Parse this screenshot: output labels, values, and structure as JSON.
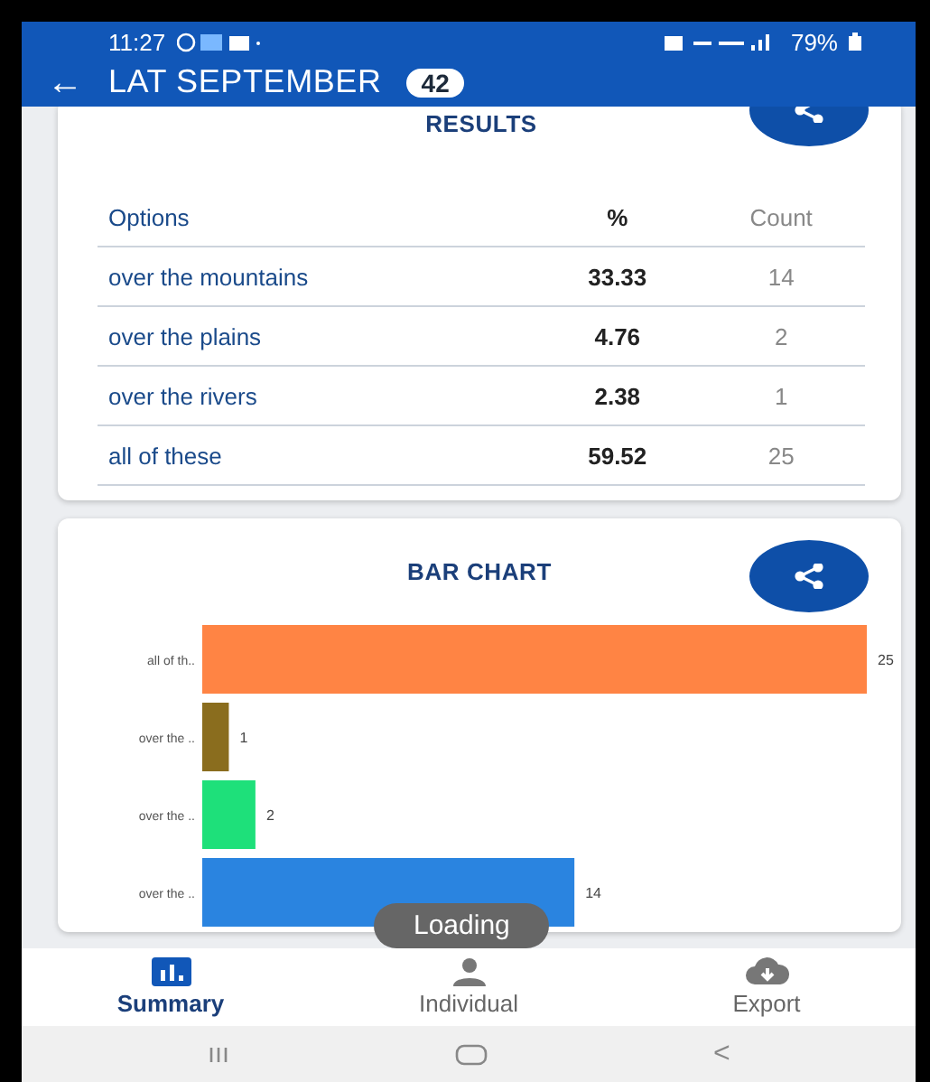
{
  "status_bar": {
    "time": "11:27",
    "battery": "79%"
  },
  "app_bar": {
    "back": "←",
    "title": "LAT SEPTEMBER",
    "badge": "42"
  },
  "results": {
    "title": "RESULTS",
    "columns": [
      "Options",
      "%",
      "Count"
    ],
    "rows": [
      {
        "option": "over the mountains",
        "percent": "33.33",
        "count": "14"
      },
      {
        "option": "over the plains",
        "percent": "4.76",
        "count": "2"
      },
      {
        "option": "over the rivers",
        "percent": "2.38",
        "count": "1"
      },
      {
        "option": "all of these",
        "percent": "59.52",
        "count": "25"
      }
    ]
  },
  "bar_chart": {
    "title": "BAR CHART",
    "chart_data": {
      "type": "bar",
      "orientation": "horizontal",
      "categories": [
        "all of th..",
        "over the ..",
        "over the ..",
        "over the .."
      ],
      "values": [
        25,
        1,
        2,
        14
      ],
      "colors": [
        "#ff8444",
        "#8a6d1e",
        "#1ee07a",
        "#2a84e0"
      ],
      "data_labels": true
    }
  },
  "toast": "Loading",
  "bottom_nav": [
    {
      "label": "Summary",
      "kind": "chart",
      "selected": true
    },
    {
      "label": "Individual",
      "kind": "person",
      "selected": false
    },
    {
      "label": "Export",
      "kind": "cloud",
      "selected": false
    }
  ],
  "system_nav": {
    "back": "<"
  }
}
